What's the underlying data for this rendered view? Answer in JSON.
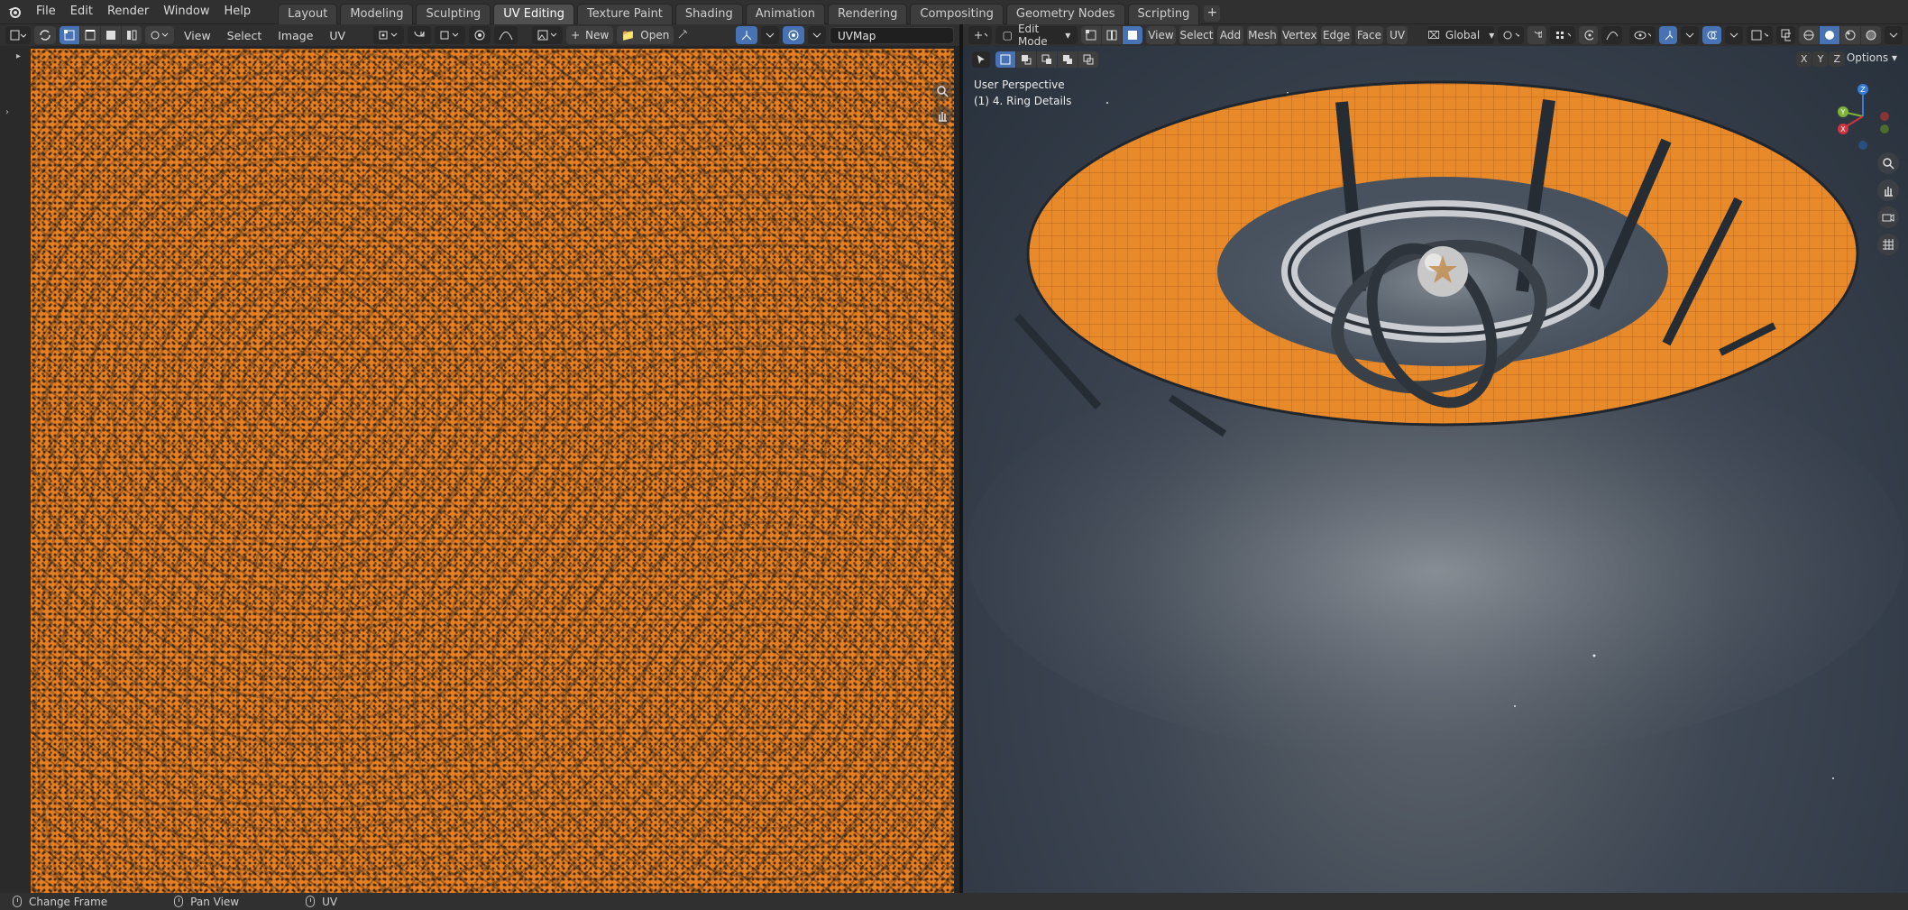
{
  "topbar": {
    "menus": [
      "File",
      "Edit",
      "Render",
      "Window",
      "Help"
    ],
    "tabs": [
      {
        "label": "Layout",
        "active": false
      },
      {
        "label": "Modeling",
        "active": false
      },
      {
        "label": "Sculpting",
        "active": false
      },
      {
        "label": "UV Editing",
        "active": true
      },
      {
        "label": "Texture Paint",
        "active": false
      },
      {
        "label": "Shading",
        "active": false
      },
      {
        "label": "Animation",
        "active": false
      },
      {
        "label": "Rendering",
        "active": false
      },
      {
        "label": "Compositing",
        "active": false
      },
      {
        "label": "Geometry Nodes",
        "active": false
      },
      {
        "label": "Scripting",
        "active": false
      }
    ],
    "add_tab": "+"
  },
  "uv_editor": {
    "menus": [
      "View",
      "Select",
      "Image",
      "UV"
    ],
    "new_label": "New",
    "open_label": "Open",
    "uvmap_value": "UVMap"
  },
  "viewport": {
    "mode": "Edit Mode",
    "menus": [
      "View",
      "Select",
      "Add",
      "Mesh",
      "Vertex",
      "Edge",
      "Face",
      "UV"
    ],
    "transform_orientation": "Global",
    "perspective_label": "User Perspective",
    "object_label": "(1) 4. Ring Details",
    "axis_buttons": [
      "X",
      "Y",
      "Z"
    ],
    "options_label": "Options",
    "gizmo_axes": {
      "x": "X",
      "y": "Y",
      "z": "Z"
    }
  },
  "statusbar": {
    "items": [
      {
        "label": "Change Frame"
      },
      {
        "label": "Pan View"
      },
      {
        "label": "UV"
      }
    ]
  },
  "colors": {
    "accent": "#4772b3",
    "uv_orange": "#e67e22",
    "active_tab": "#505050"
  }
}
